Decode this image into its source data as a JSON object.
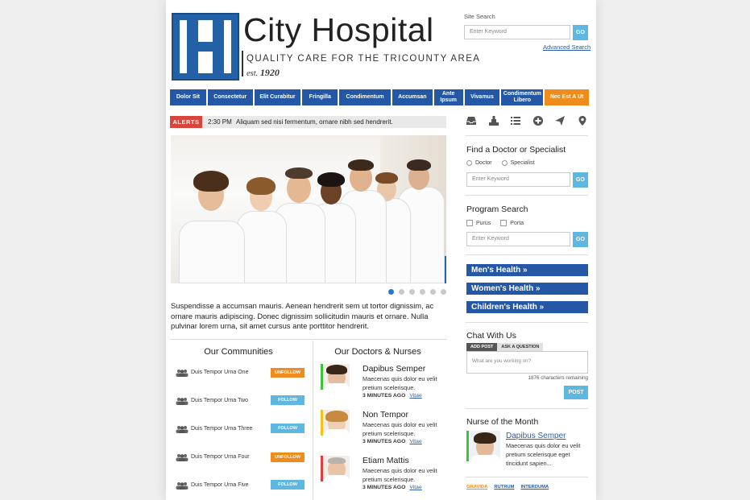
{
  "header": {
    "title": "City Hospital",
    "tagline": "QUALITY CARE FOR THE TRICOUNTY AREA",
    "est_prefix": "est.",
    "est_year": "1920"
  },
  "site_search": {
    "label": "Site Search",
    "placeholder": "Enter Keyword",
    "go_label": "GO",
    "advanced_label": "Advanced Search"
  },
  "nav": {
    "items": [
      {
        "label": "Dolor Sit"
      },
      {
        "label": "Consectetur"
      },
      {
        "label": "Elit Curabitur"
      },
      {
        "label": "Fringilla"
      },
      {
        "label": "Condimentum"
      },
      {
        "label": "Accumsan"
      },
      {
        "label": "Ante Ipsum"
      },
      {
        "label": "Vivamus"
      },
      {
        "label": "Condimentum Libero"
      },
      {
        "label": "Nec Est A Ut"
      }
    ],
    "highlight_color": "#ef8c1b",
    "primary_color": "#2458a6"
  },
  "alerts": {
    "badge": "ALERTS",
    "time": "2:30 PM",
    "text": "Aliquam sed nisi fermentum, ornare nibh sed hendrerit."
  },
  "carousel": {
    "slide_count": 6,
    "active_index": 0
  },
  "intro": {
    "text": "Suspendisse a accumsan mauris. Aenean hendrerit sem ut tortor dignissim, ac ornare mauris adipiscing. Donec dignissim sollicitudin mauris et ornare. Nulla pulvinar lorem urna, sit amet cursus ante porttitor hendrerit."
  },
  "communities": {
    "title": "Our Communities",
    "items": [
      {
        "label": "Duis Tempor Urna One",
        "button": "UNFOLLOW"
      },
      {
        "label": "Duis Tempor Urna Two",
        "button": "FOLLOW"
      },
      {
        "label": "Duis Tempor Urna Three",
        "button": "FOLLOW"
      },
      {
        "label": "Duis Tempor Urna Four",
        "button": "UNFOLLOW"
      },
      {
        "label": "Duis Tempor Urna Five",
        "button": "FOLLOW"
      }
    ]
  },
  "doctors": {
    "title": "Our Doctors & Nurses",
    "items": [
      {
        "name": "Dapibus Semper",
        "desc": "Maecenas quis dolor eu velit pretium scelerisque.",
        "time": "3 MINUTES AGO",
        "link": "Vitae",
        "stripe": "#3cc43c"
      },
      {
        "name": "Non Tempor",
        "desc": "Maecenas quis dolor eu velit pretium scelerisque.",
        "time": "3 MINUTES AGO",
        "link": "Vitae",
        "stripe": "#f2c21b"
      },
      {
        "name": "Etiam Mattis",
        "desc": "Maecenas quis dolor eu velit pretium scelerisque.",
        "time": "3 MINUTES AGO",
        "link": "Vitae",
        "stripe": "#e23b3b"
      }
    ]
  },
  "sidebar": {
    "icons": [
      "inbox-icon",
      "podium-icon",
      "list-icon",
      "plus-circle-icon",
      "send-icon",
      "map-pin-icon"
    ],
    "find_doctor": {
      "title": "Find a Doctor or Specialist",
      "options": [
        "Doctor",
        "Specialist"
      ],
      "placeholder": "Enter Keyword",
      "go_label": "GO"
    },
    "program_search": {
      "title": "Program Search",
      "options": [
        "Purus",
        "Porta"
      ],
      "placeholder": "Enter Keyword",
      "go_label": "GO"
    },
    "health_links": [
      "Men's Health »",
      "Women's Health »",
      "Children's Health »"
    ],
    "chat": {
      "title": "Chat With Us",
      "tab_post": "ADD POST",
      "tab_question": "ASK A QUESTION",
      "placeholder": "What are you working on?",
      "chars_remaining": "1876 characters remaining",
      "post_label": "POST"
    },
    "nurse": {
      "title": "Nurse of the Month",
      "name": "Dapibus Semper",
      "desc": "Maecenas quis dolor eu velit pretium scelerisque eget tincidunt sapien...",
      "tags": [
        {
          "label": "GRAVIDA",
          "color": "#ef8c1b"
        },
        {
          "label": "RUTRUM",
          "color": "#2458a6"
        },
        {
          "label": "INTERDUMA",
          "color": "#2458a6"
        }
      ]
    }
  }
}
